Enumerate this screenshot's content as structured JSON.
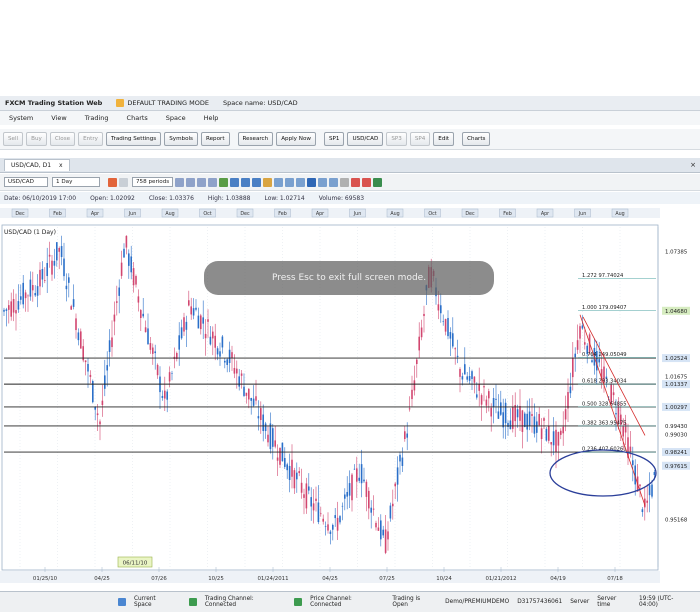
{
  "window": {
    "app_title": "FXCM Trading Station Web",
    "mode": "DEFAULT TRADING MODE",
    "space_name": "Space name: USD/CAD"
  },
  "menu": [
    "System",
    "View",
    "Trading",
    "Charts",
    "Space",
    "Help"
  ],
  "toolbar": {
    "buttons": [
      {
        "label": "Sell",
        "enabled": false
      },
      {
        "label": "Buy",
        "enabled": false
      },
      {
        "label": "Close",
        "enabled": false
      },
      {
        "label": "Entry",
        "enabled": false
      },
      {
        "label": "Trading Settings",
        "enabled": true
      },
      {
        "label": "Symbols",
        "enabled": true
      },
      {
        "label": "Report",
        "enabled": true
      },
      {
        "label": "Research",
        "enabled": true
      },
      {
        "label": "Apply Now",
        "enabled": true
      },
      {
        "label": "SP1",
        "enabled": true
      },
      {
        "label": "USD/CAD",
        "enabled": true
      },
      {
        "label": "SP3",
        "enabled": false
      },
      {
        "label": "SP4",
        "enabled": false
      },
      {
        "label": "Edit",
        "enabled": true
      },
      {
        "label": "Charts",
        "enabled": true
      }
    ]
  },
  "chart_tab": {
    "label": "USD/CAD, D1",
    "close": "x"
  },
  "chart_toolbar": {
    "symbol": "USD/CAD",
    "timeframe": "1 Day",
    "periods": "758 periods"
  },
  "info": {
    "date": "Date: 06/10/2019 17:00",
    "open": "Open: 1.02092",
    "close": "Close: 1.03376",
    "high": "High: 1.03888",
    "low": "Low: 1.02714",
    "volume": "Volume: 69583"
  },
  "chart_title": "USD/CAD (1 Day)",
  "top_months": [
    "Dec",
    "Feb",
    "Apr",
    "Jun",
    "Aug",
    "Oct",
    "Dec",
    "Feb",
    "Apr",
    "Jun",
    "Aug",
    "Oct",
    "Dec",
    "Feb",
    "Apr",
    "Jun",
    "Aug"
  ],
  "bottom_dates": [
    "01/25/10",
    "04/25",
    "07/26",
    "10/25",
    "01/24/2011",
    "04/25",
    "07/25",
    "10/24",
    "01/21/2012",
    "04/19",
    "07/18"
  ],
  "cursor_date": "06/11/10",
  "price_labels": [
    "1.07385",
    "1.04680",
    "1.02524",
    "1.01675",
    "1.01337",
    "1.00297",
    "0.99430",
    "0.99030",
    "0.98241",
    "0.97615",
    "0.95168"
  ],
  "fib_labels": [
    "1.272  97.74024",
    "1.000  179.09407",
    "0.764  249.05049",
    "0.618  293.34034",
    "0.500  328.64855",
    "0.382  363.95475",
    "0.236  407.60261"
  ],
  "overlay_text": "Press Esc to exit full screen mode.",
  "status": {
    "current_space": "Current Space",
    "trading_channel": "Trading Channel: Connected",
    "price_channel": "Price Channel: Connected",
    "trading_open": "Trading is Open",
    "account": "Demo/PREMIUMDEMO",
    "account_id": "D31757436061",
    "server": "Server",
    "server_time": "Server time",
    "clock": "19:59 (UTC-04:00)"
  },
  "colors": {
    "bull": "#2a6fc9",
    "bear": "#d2466f",
    "fib_line": "#222222",
    "trend": "#d42a2a",
    "ellipse": "#2b3f9a",
    "price_highlight_green": "#d6ecc0",
    "price_highlight_blue": "#d6e4f5"
  },
  "chart_data": {
    "type": "candlestick",
    "price_levels": [
      1.07385,
      1.0468,
      1.02524,
      1.01675,
      1.01337,
      1.00297,
      0.9943,
      0.9903,
      0.98241,
      0.97615,
      0.95168
    ],
    "fib_ratios": [
      1.272,
      1.0,
      0.764,
      0.618,
      0.5,
      0.382,
      0.236
    ],
    "ylim": [
      0.93,
      1.085
    ]
  }
}
